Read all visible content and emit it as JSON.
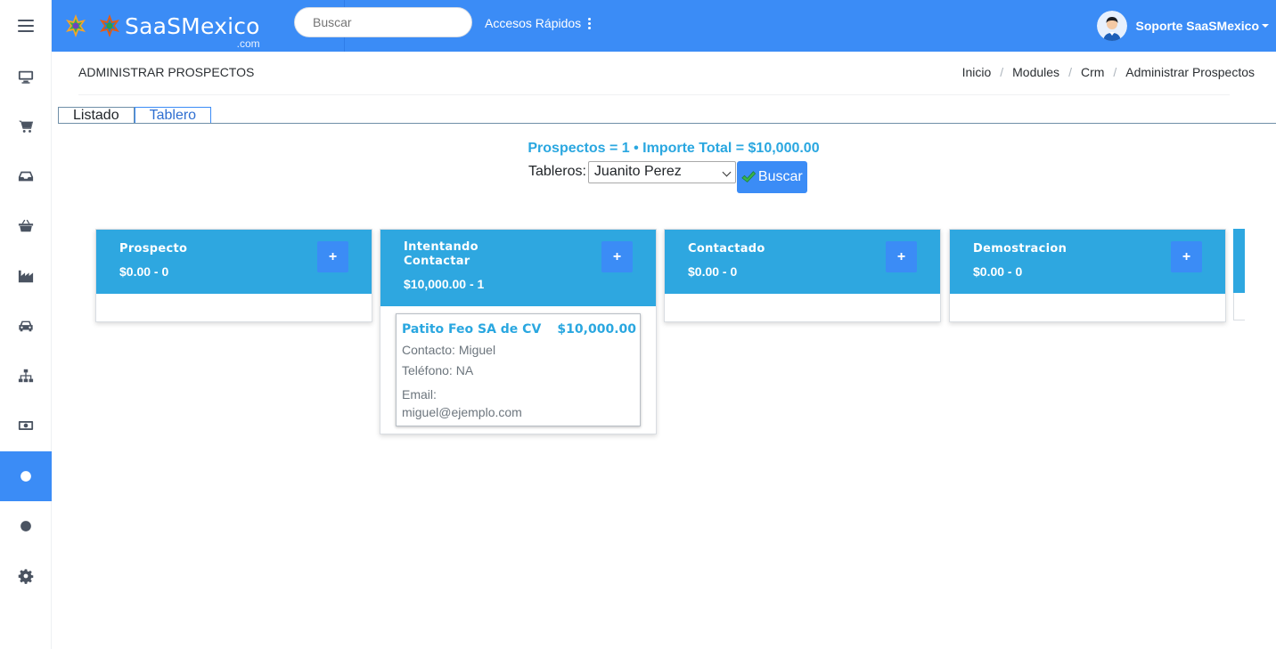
{
  "brand": {
    "name": "SaaSMexico",
    "suffix": ".com"
  },
  "search": {
    "placeholder": "Buscar"
  },
  "quick_access": {
    "label": "Accesos Rápidos"
  },
  "user": {
    "name": "Soporte SaaSMexico"
  },
  "sidebar": {
    "items": [
      {
        "icon": "monitor-icon"
      },
      {
        "icon": "cart-icon"
      },
      {
        "icon": "inbox-icon"
      },
      {
        "icon": "basket-icon"
      },
      {
        "icon": "factory-icon"
      },
      {
        "icon": "car-icon"
      },
      {
        "icon": "sitemap-icon"
      },
      {
        "icon": "money-icon"
      },
      {
        "icon": "circle-icon",
        "active": true
      },
      {
        "icon": "circle-icon"
      },
      {
        "icon": "gear-icon"
      }
    ]
  },
  "page": {
    "title": "ADMINISTRAR PROSPECTOS",
    "breadcrumb": [
      "Inicio",
      "Modules",
      "Crm",
      "Administrar Prospectos"
    ]
  },
  "tabs": [
    {
      "label": "Listado",
      "active": false
    },
    {
      "label": "Tablero",
      "active": true
    }
  ],
  "summary": "Prospectos = 1 • Importe Total = $10,000.00",
  "filter": {
    "label": "Tableros:",
    "selected": "Juanito Perez",
    "button": "Buscar"
  },
  "board": {
    "columns": [
      {
        "title": "Prospecto",
        "amount": "$0.00 - 0"
      },
      {
        "title": "Intentando Contactar",
        "amount": "$10,000.00 - 1"
      },
      {
        "title": "Contactado",
        "amount": "$0.00 - 0"
      },
      {
        "title": "Demostracion",
        "amount": "$0.00 - 0"
      }
    ],
    "card": {
      "company": "Patito Feo SA de CV",
      "amount": "$10,000.00",
      "contact": "Contacto: Miguel",
      "phone": "Teléfono: NA",
      "email_label": "Email:",
      "email": "miguel@ejemplo.com"
    }
  },
  "colors": {
    "primary": "#3b8cf6",
    "column_header": "#2ea7e0",
    "accent_text": "#2aa7e0"
  }
}
